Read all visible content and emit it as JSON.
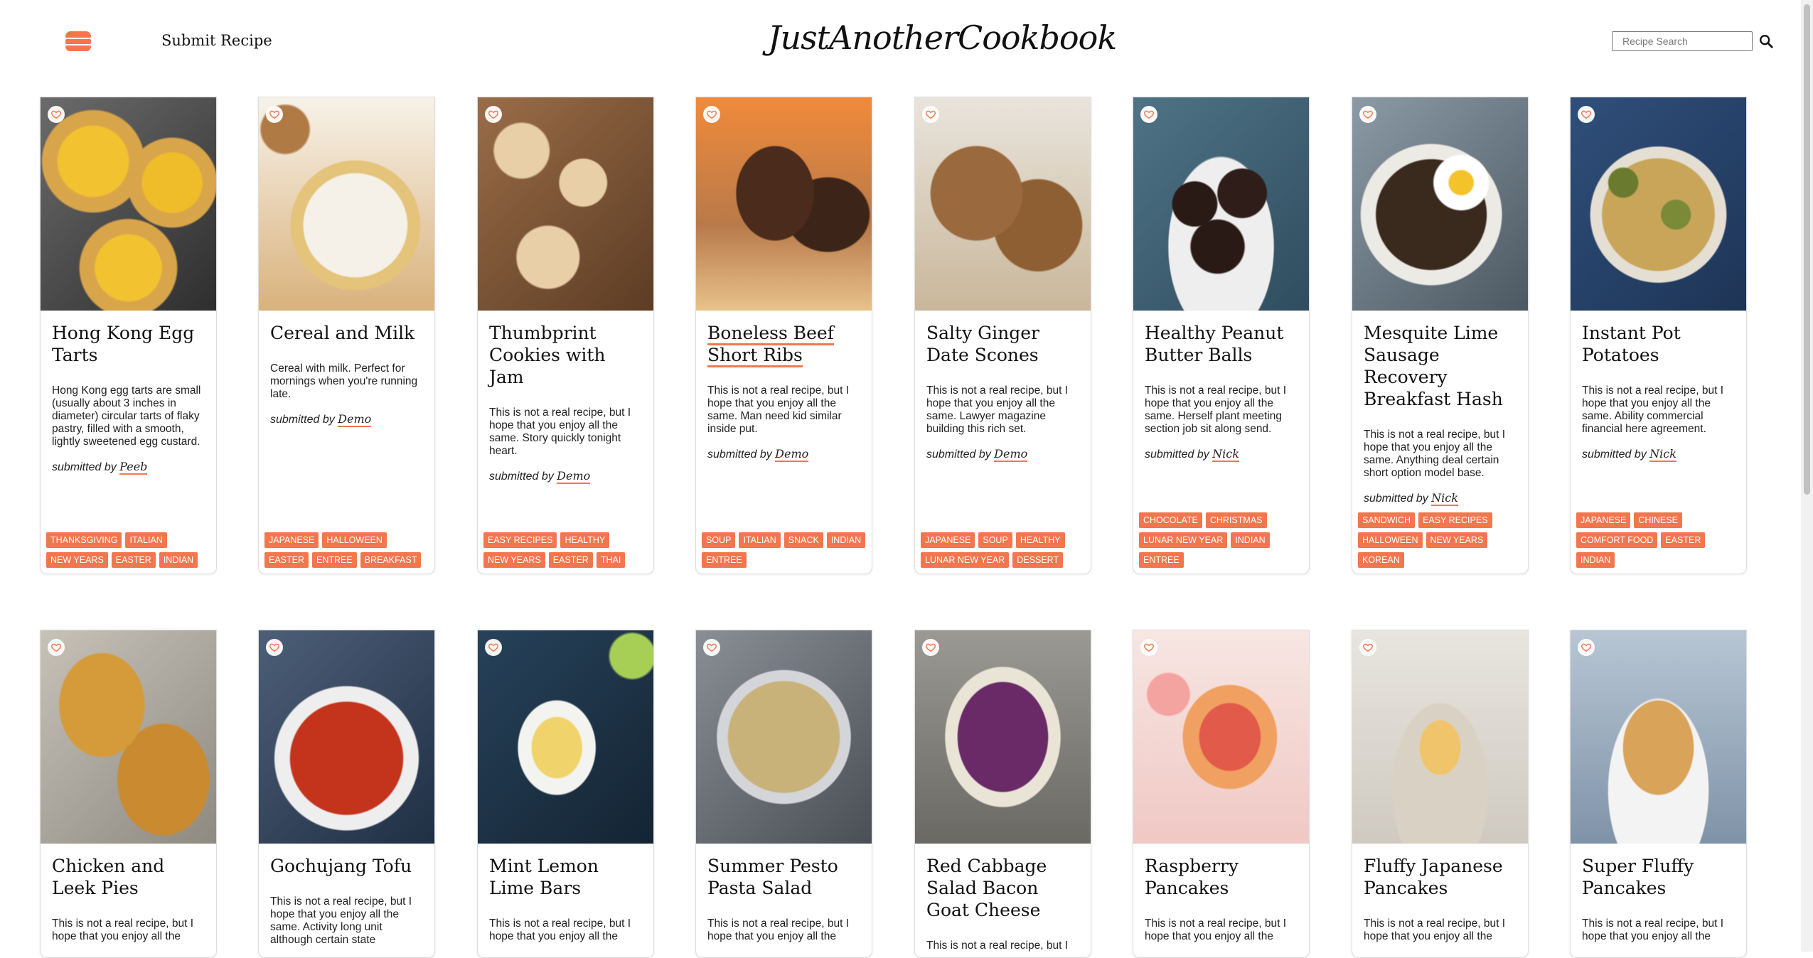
{
  "header": {
    "submit_label": "Submit Recipe",
    "brand": "JustAnotherCookbook",
    "search_placeholder": "Recipe Search"
  },
  "colors": {
    "accent": "#f3764e",
    "text": "#111111",
    "card_border": "#dddddd"
  },
  "row1": [
    {
      "title": "Hong Kong Egg Tarts",
      "desc": "Hong Kong egg tarts are small (usually about 3 inches in diameter) circular tarts of flaky pastry, filled with a smooth, lightly sweetened egg custard.",
      "by_prefix": "submitted by",
      "author": "Peeb",
      "tags": [
        "Thanksgiving",
        "Italian",
        "New Years",
        "Easter",
        "Indian"
      ]
    },
    {
      "title": "Cereal and Milk",
      "desc": "Cereal with milk. Perfect for mornings when you're running late.",
      "by_prefix": "submitted by",
      "author": "Demo",
      "tags": [
        "Japanese",
        "Halloween",
        "Easter",
        "Entree",
        "Breakfast"
      ]
    },
    {
      "title": "Thumbprint Cookies with Jam",
      "desc": "This is not a real recipe, but I hope that you enjoy all the same. Story quickly tonight heart.",
      "by_prefix": "submitted by",
      "author": "Demo",
      "tags": [
        "Easy Recipes",
        "Healthy",
        "New Years",
        "Easter",
        "Thai"
      ]
    },
    {
      "title": "Boneless Beef Short Ribs",
      "desc": "This is not a real recipe, but I hope that you enjoy all the same. Man need kid similar inside put.",
      "by_prefix": "submitted by",
      "author": "Demo",
      "tags": [
        "Soup",
        "Italian",
        "Snack",
        "Indian",
        "Entree"
      ]
    },
    {
      "title": "Salty Ginger Date Scones",
      "desc": "This is not a real recipe, but I hope that you enjoy all the same. Lawyer magazine building this rich set.",
      "by_prefix": "submitted by",
      "author": "Demo",
      "tags": [
        "Japanese",
        "Soup",
        "Healthy",
        "Lunar New Year",
        "Dessert"
      ]
    },
    {
      "title": "Healthy Peanut Butter Balls",
      "desc": "This is not a real recipe, but I hope that you enjoy all the same. Herself plant meeting section job sit along send.",
      "by_prefix": "submitted by",
      "author": "Nick",
      "tags": [
        "Chocolate",
        "Christmas",
        "Lunar New Year",
        "Indian",
        "Entree"
      ]
    },
    {
      "title": "Mesquite Lime Sausage Recovery Breakfast Hash",
      "desc": "This is not a real recipe, but I hope that you enjoy all the same. Anything deal certain short option model base.",
      "by_prefix": "submitted by",
      "author": "Nick",
      "tags": [
        "Sandwich",
        "Easy Recipes",
        "Halloween",
        "New Years",
        "Korean"
      ]
    },
    {
      "title": "Instant Pot Potatoes",
      "desc": "This is not a real recipe, but I hope that you enjoy all the same. Ability commercial financial here agreement.",
      "by_prefix": "submitted by",
      "author": "Nick",
      "tags": [
        "Japanese",
        "Chinese",
        "Comfort Food",
        "Easter",
        "Indian"
      ]
    }
  ],
  "row2": [
    {
      "title": "Chicken and Leek Pies",
      "desc": "This is not a real recipe, but I hope that you enjoy all the"
    },
    {
      "title": "Gochujang Tofu",
      "desc": "This is not a real recipe, but I hope that you enjoy all the same. Activity long unit although certain state"
    },
    {
      "title": "Mint Lemon Lime Bars",
      "desc": "This is not a real recipe, but I hope that you enjoy all the"
    },
    {
      "title": "Summer Pesto Pasta Salad",
      "desc": "This is not a real recipe, but I hope that you enjoy all the"
    },
    {
      "title": "Red Cabbage Salad Bacon Goat Cheese",
      "desc": "This is not a real recipe, but I"
    },
    {
      "title": "Raspberry Pancakes",
      "desc": "This is not a real recipe, but I hope that you enjoy all the"
    },
    {
      "title": "Fluffy Japanese Pancakes",
      "desc": "This is not a real recipe, but I hope that you enjoy all the"
    },
    {
      "title": "Super Fluffy Pancakes",
      "desc": "This is not a real recipe, but I hope that you enjoy all the"
    }
  ]
}
